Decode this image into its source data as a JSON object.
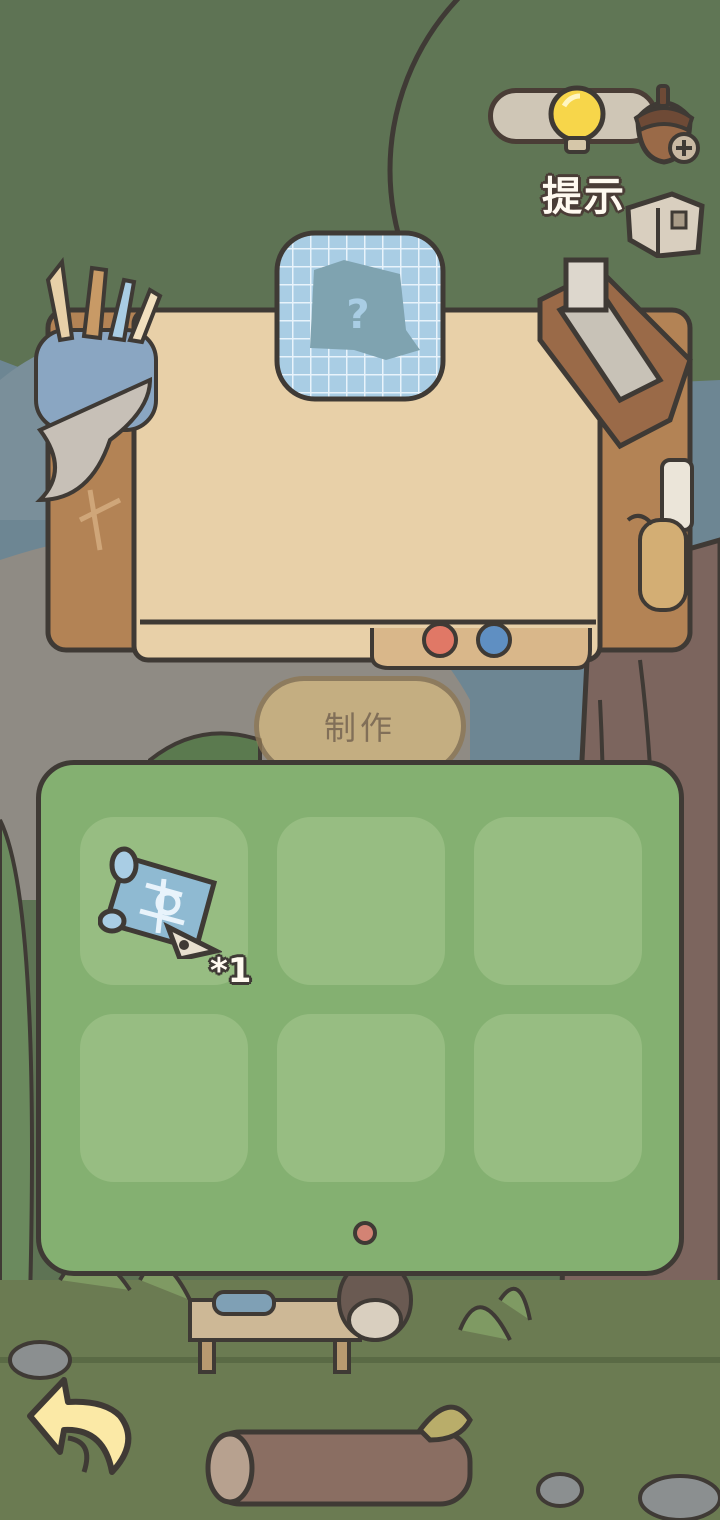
{
  "hint": {
    "label": "提示"
  },
  "crafting": {
    "make_label": "制作"
  },
  "inventory": {
    "slots": [
      {
        "item": "blueprint-scroll",
        "count": "*1"
      },
      {
        "item": ""
      },
      {
        "item": ""
      },
      {
        "item": ""
      },
      {
        "item": ""
      },
      {
        "item": ""
      }
    ],
    "page_count": 1,
    "current_page": 1
  },
  "colors": {
    "forest": "#5f7356",
    "workbench_paper": "#e8d0a8",
    "inventory_panel": "#84b071",
    "slot": "#97bd82",
    "outline": "#3f3a35",
    "page_dot": "#d38374",
    "bulb": "#f7d64a"
  },
  "icons": [
    "lightbulb-icon",
    "acorn-icon",
    "hint-book-icon",
    "unknown-recipe-icon",
    "blueprint-scroll-icon",
    "back-arrow-icon"
  ]
}
